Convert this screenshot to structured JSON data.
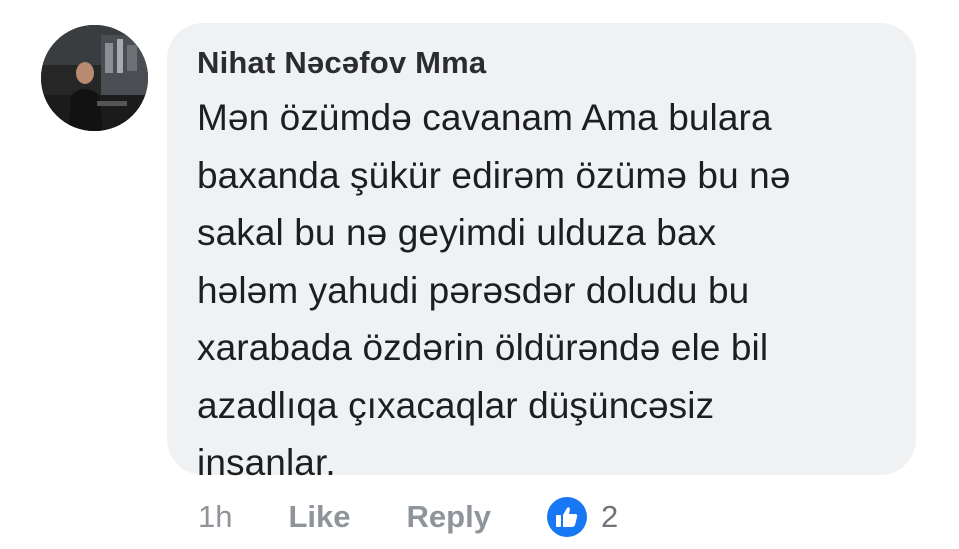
{
  "comment": {
    "author": "Nihat Nəcəfov Mma",
    "text_lines": [
      "Mən özümdə cavanam Ama bulara",
      "baxanda şükür edirəm özümə bu nə",
      "sakal bu nə geyimdi ulduza bax",
      "hələm yahudi pərəsdər doludu bu",
      "xarabada özdərin öldürəndə ele bil",
      "azadlıqa çıxacaqlar düşüncəsiz",
      "insanlar."
    ],
    "timestamp": "1h",
    "like_label": "Like",
    "reply_label": "Reply",
    "reaction_count": "2",
    "reaction_icon": "thumbs-up-icon",
    "colors": {
      "bubble": "#f0f1f3",
      "reaction_badge": "#1877f2",
      "meta_text": "#8f949b"
    }
  }
}
